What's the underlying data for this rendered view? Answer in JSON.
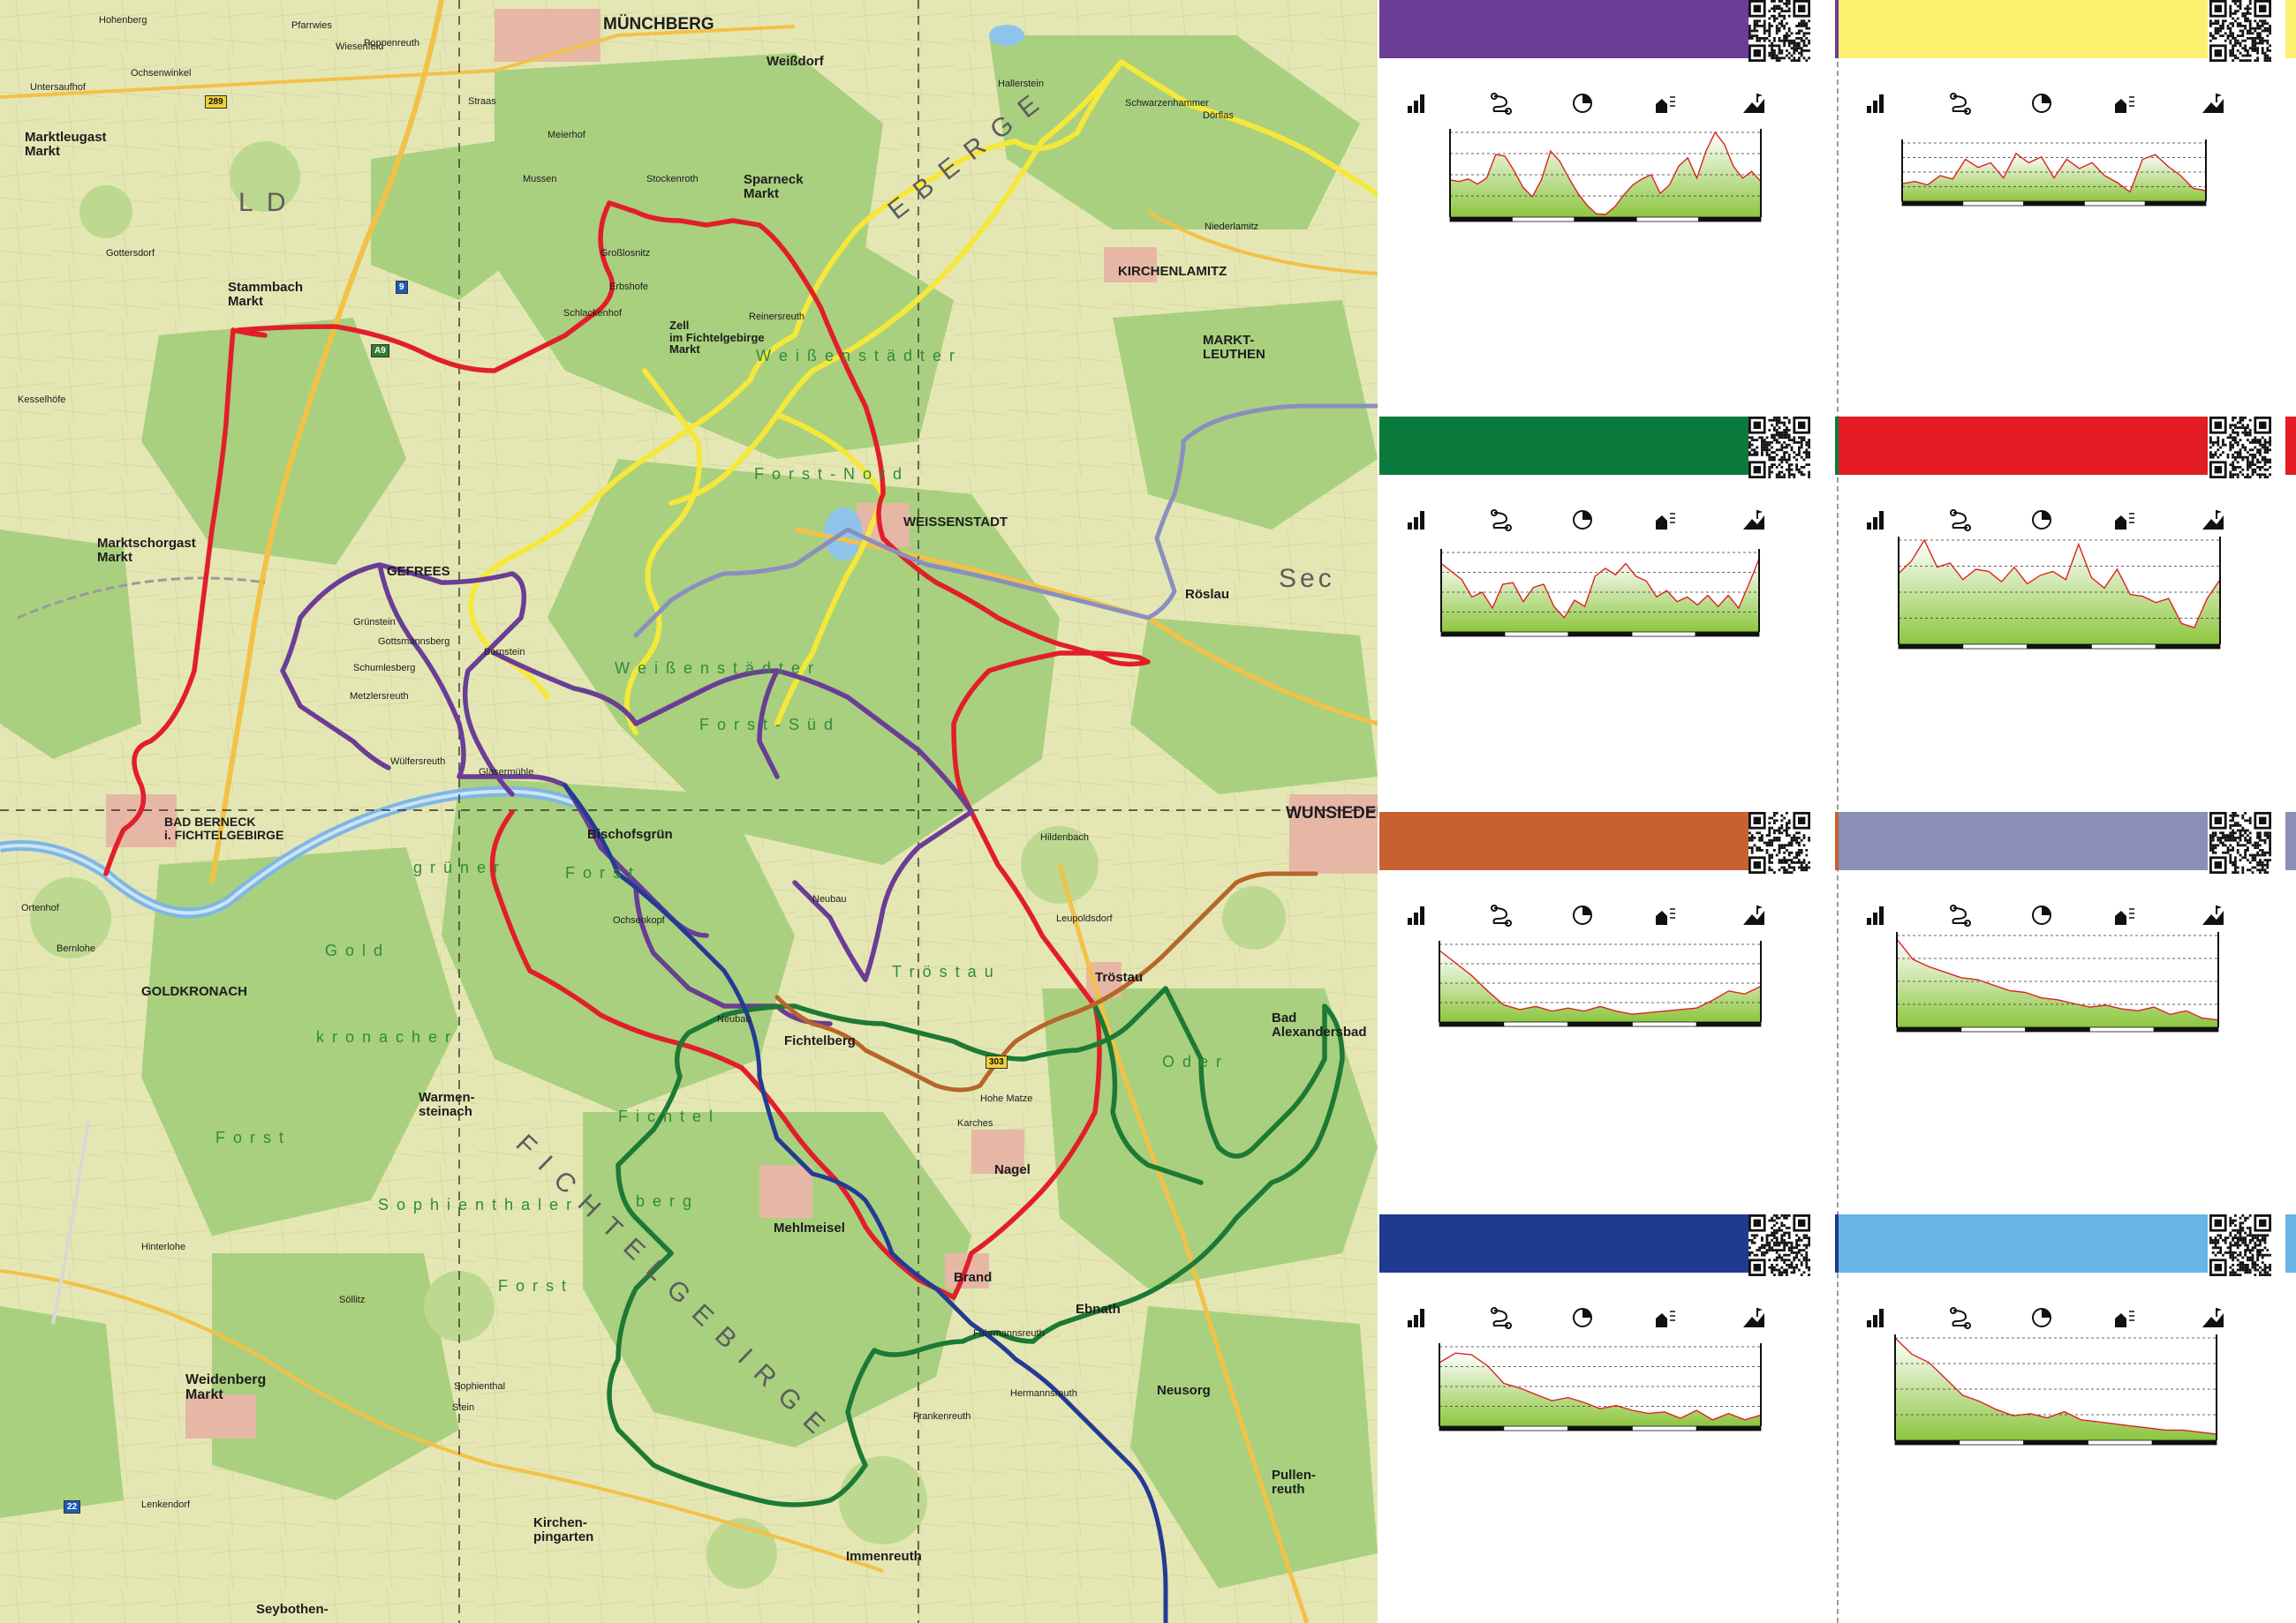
{
  "map": {
    "towns": [
      {
        "name": "MÜNCHBERG",
        "cls": "big"
      },
      {
        "name": "Weißdorf",
        "cls": "mid"
      },
      {
        "name": "Sparneck\nMarkt",
        "cls": "mid"
      },
      {
        "name": "KIRCHENLAMITZ",
        "cls": "mid"
      },
      {
        "name": "MARKT-\nLEUTHEN",
        "cls": "mid"
      },
      {
        "name": "Marktleugast\nMarkt",
        "cls": "mid"
      },
      {
        "name": "Stammbach\nMarkt",
        "cls": "mid"
      },
      {
        "name": "Zell\nim Fichtelgebirge\nMarkt",
        "cls": "mid"
      },
      {
        "name": "WEISSENSTADT",
        "cls": "mid"
      },
      {
        "name": "Röslau",
        "cls": "mid"
      },
      {
        "name": "Marktschorgast\nMarkt",
        "cls": "mid"
      },
      {
        "name": "GEFREES",
        "cls": "mid"
      },
      {
        "name": "WUNSIEDEL",
        "cls": "big"
      },
      {
        "name": "BAD BERNECK\ni. FICHTELGEBIRGE",
        "cls": "mid"
      },
      {
        "name": "Bischofsgrün",
        "cls": "mid"
      },
      {
        "name": "GOLDKRONACH",
        "cls": "mid"
      },
      {
        "name": "Fichtelberg",
        "cls": "mid"
      },
      {
        "name": "Tröstau",
        "cls": "mid"
      },
      {
        "name": "Bad\nAlexandersbad",
        "cls": "mid"
      },
      {
        "name": "Warmen-\nsteinach",
        "cls": "mid"
      },
      {
        "name": "Nagel",
        "cls": "mid"
      },
      {
        "name": "Mehlmeisel",
        "cls": "mid"
      },
      {
        "name": "Brand",
        "cls": "mid"
      },
      {
        "name": "Ebnath",
        "cls": "mid"
      },
      {
        "name": "Weidenberg\nMarkt",
        "cls": "mid"
      },
      {
        "name": "Neusorg",
        "cls": "mid"
      },
      {
        "name": "Pullen-\nreuth",
        "cls": "mid"
      },
      {
        "name": "Kirchen-\npingarten",
        "cls": "mid"
      },
      {
        "name": "Immenreuth",
        "cls": "mid"
      },
      {
        "name": "Seybothen-",
        "cls": "mid"
      }
    ],
    "villages": [
      "Hohenberg",
      "Untersaufhof",
      "Ochsenwinkel",
      "Gottersdorf",
      "Pfarrwies",
      "Wiesenfeld",
      "Kesselhöfe",
      "Straas",
      "Mussen",
      "Meierhof",
      "Stockenroth",
      "Großlosnitz",
      "Erbshofe",
      "Schlackenhof",
      "Reinersreuth",
      "Hallerstein",
      "Niederlamitz",
      "Dörflas",
      "Schwarzenhammer",
      "Leupoldsdorf",
      "Neubau",
      "Hildenbach",
      "Bernstein",
      "Gottsmannsberg",
      "Grünstein",
      "Schumlesberg",
      "Metzlersreuth",
      "Wülfersreuth",
      "Glasermühle",
      "Ochsenkopf",
      "Neubau",
      "Karches",
      "Hohe Matze",
      "Fuhrmannsreuth",
      "Hermannsreuth",
      "Frankenreuth",
      "Stein",
      "Sophienthal",
      "Lenkendorf",
      "Hinterlohe",
      "Söllitz",
      "Ortenhof",
      "Bernlohe",
      "Poppenreuth"
    ],
    "forests": [
      {
        "name": "W e i ß e n s t ä d t e r",
        "cls": "forest"
      },
      {
        "name": "F o r s t - N o r d",
        "cls": "forest"
      },
      {
        "name": "W e i ß e n s t ä d t e r",
        "cls": "forest"
      },
      {
        "name": "F o r s t - S ü d",
        "cls": "forest"
      },
      {
        "name": "G o l d",
        "cls": "forest"
      },
      {
        "name": "k r o n a c h e r",
        "cls": "forest"
      },
      {
        "name": "F o r s t",
        "cls": "forest"
      },
      {
        "name": "S o p h i e n t h a l e r",
        "cls": "forest"
      },
      {
        "name": "F i c h t e l",
        "cls": "forest"
      },
      {
        "name": "b e r g",
        "cls": "forest"
      },
      {
        "name": "F o r s t",
        "cls": "forest"
      },
      {
        "name": "g r ü n e r",
        "cls": "forest"
      },
      {
        "name": "F o r s t",
        "cls": "forest"
      },
      {
        "name": "T r ö s t a u",
        "cls": "forest"
      },
      {
        "name": "O d e r",
        "cls": "forest"
      }
    ],
    "ranges": [
      {
        "name": "F I C H T E L G E B I R G E",
        "cls": "range"
      },
      {
        "name": "E  B  E  R  G  E",
        "cls": "range"
      },
      {
        "name": "L  D",
        "cls": "range"
      },
      {
        "name": "Sec",
        "cls": "range"
      }
    ],
    "roads": [
      {
        "name": "289",
        "style": "y"
      },
      {
        "name": "303",
        "style": "y"
      },
      {
        "name": "22",
        "style": "b"
      },
      {
        "name": "9",
        "style": "b"
      },
      {
        "name": "A9",
        "style": "b"
      }
    ],
    "colors": {
      "red": "#e2242a",
      "yellow": "#f5ea3a",
      "purple": "#6c3f9b",
      "green": "#1c7a34",
      "blue": "#223a97",
      "gray": "#8a8fbd",
      "orange": "#b8672a",
      "water": "#8fc0e6"
    }
  },
  "routes": [
    {
      "id": "purple",
      "color": "#6a3d96",
      "profile": [
        0.44,
        0.42,
        0.45,
        0.39,
        0.46,
        0.74,
        0.72,
        0.55,
        0.35,
        0.24,
        0.44,
        0.78,
        0.66,
        0.46,
        0.28,
        0.14,
        0.04,
        0.03,
        0.12,
        0.26,
        0.38,
        0.45,
        0.5,
        0.28,
        0.38,
        0.6,
        0.7,
        0.46,
        0.78,
        1.0,
        0.86,
        0.6,
        0.46,
        0.54,
        0.42
      ],
      "grid": 4
    },
    {
      "id": "yellow",
      "color": "#fdf06e",
      "profile": [
        0.3,
        0.34,
        0.28,
        0.44,
        0.38,
        0.72,
        0.58,
        0.66,
        0.4,
        0.82,
        0.66,
        0.76,
        0.4,
        0.72,
        0.56,
        0.66,
        0.44,
        0.32,
        0.16,
        0.72,
        0.8,
        0.6,
        0.44,
        0.22,
        0.18
      ],
      "grid": 4
    },
    {
      "id": "green",
      "color": "#0a7a3c",
      "profile": [
        0.86,
        0.76,
        0.66,
        0.44,
        0.5,
        0.3,
        0.6,
        0.62,
        0.38,
        0.56,
        0.6,
        0.32,
        0.18,
        0.4,
        0.32,
        0.7,
        0.8,
        0.72,
        0.86,
        0.7,
        0.64,
        0.44,
        0.52,
        0.38,
        0.44,
        0.34,
        0.46,
        0.32,
        0.46,
        0.3,
        0.6,
        0.92
      ],
      "grid": 4
    },
    {
      "id": "red",
      "color": "#e31b23",
      "profile": [
        0.68,
        0.8,
        1.0,
        0.74,
        0.78,
        0.62,
        0.72,
        0.7,
        0.6,
        0.74,
        0.58,
        0.66,
        0.7,
        0.62,
        0.96,
        0.64,
        0.54,
        0.72,
        0.48,
        0.46,
        0.4,
        0.44,
        0.2,
        0.16,
        0.44,
        0.62
      ],
      "grid": 4
    },
    {
      "id": "orange",
      "color": "#c8602f",
      "profile": [
        0.92,
        0.76,
        0.6,
        0.4,
        0.22,
        0.16,
        0.2,
        0.14,
        0.18,
        0.14,
        0.2,
        0.14,
        0.1,
        0.12,
        0.14,
        0.16,
        0.18,
        0.28,
        0.4,
        0.36,
        0.46
      ],
      "grid": 4
    },
    {
      "id": "gray",
      "color": "#8a90b8",
      "profile": [
        0.96,
        0.74,
        0.66,
        0.6,
        0.54,
        0.52,
        0.46,
        0.4,
        0.38,
        0.32,
        0.3,
        0.26,
        0.22,
        0.24,
        0.2,
        0.18,
        0.22,
        0.14,
        0.18,
        0.1,
        0.08
      ],
      "grid": 4
    },
    {
      "id": "blue",
      "color": "#1f3b8f",
      "profile": [
        0.8,
        0.92,
        0.9,
        0.76,
        0.54,
        0.48,
        0.4,
        0.32,
        0.36,
        0.3,
        0.22,
        0.26,
        0.2,
        0.16,
        0.18,
        0.1,
        0.2,
        0.08,
        0.16,
        0.08,
        0.14
      ],
      "grid": 4
    },
    {
      "id": "lightblue",
      "color": "#68b4e4",
      "profile": [
        1.0,
        0.84,
        0.76,
        0.6,
        0.44,
        0.38,
        0.3,
        0.24,
        0.26,
        0.22,
        0.28,
        0.2,
        0.18,
        0.16,
        0.14,
        0.12,
        0.1,
        0.1,
        0.08,
        0.06
      ],
      "grid": 4
    }
  ],
  "icons": [
    "stats-icon",
    "route-icon",
    "duration-icon",
    "climb-icon",
    "summit-icon"
  ]
}
